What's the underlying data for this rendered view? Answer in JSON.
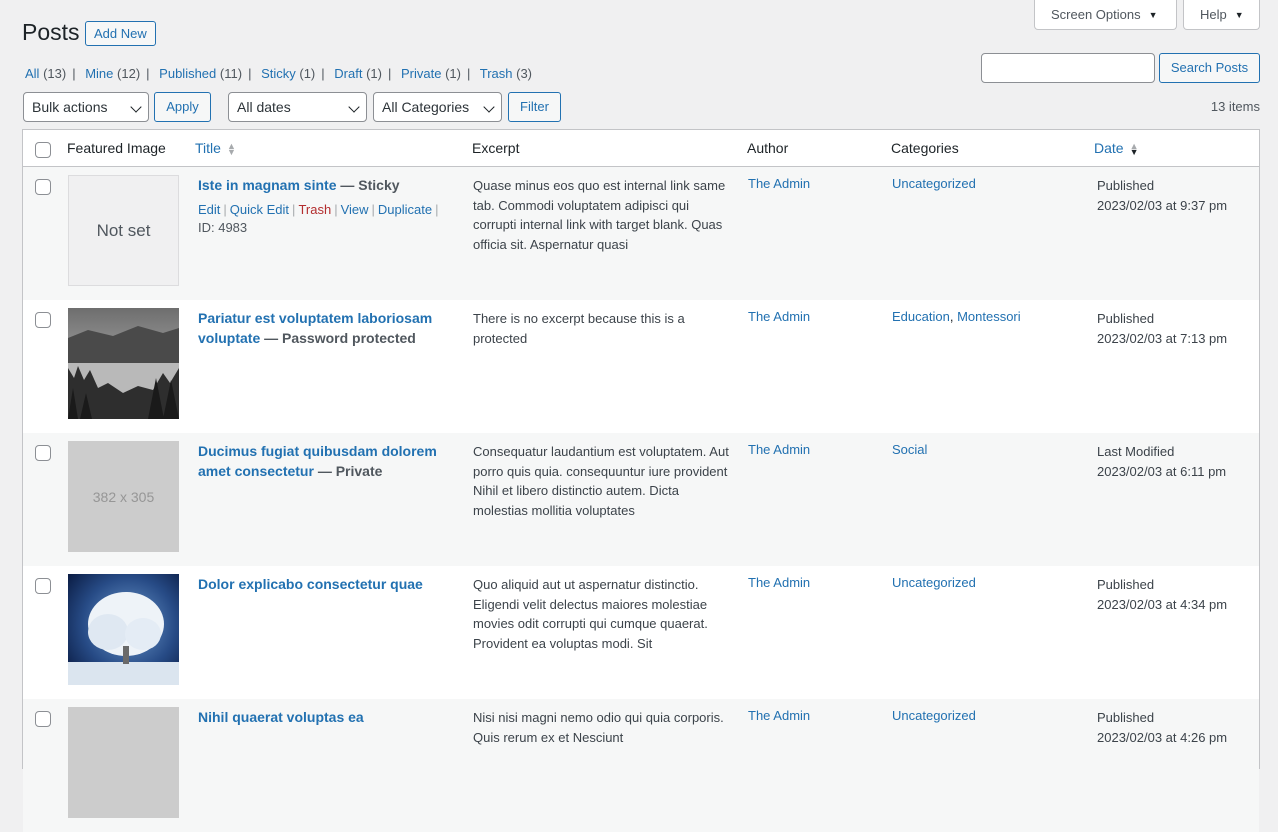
{
  "header": {
    "title": "Posts",
    "add_new": "Add New",
    "screen_options": "Screen Options",
    "help": "Help"
  },
  "views": [
    {
      "label": "All",
      "count": "(13)"
    },
    {
      "label": "Mine",
      "count": "(12)"
    },
    {
      "label": "Published",
      "count": "(11)"
    },
    {
      "label": "Sticky",
      "count": "(1)"
    },
    {
      "label": "Draft",
      "count": "(1)"
    },
    {
      "label": "Private",
      "count": "(1)"
    },
    {
      "label": "Trash",
      "count": "(3)"
    }
  ],
  "search": {
    "button": "Search Posts",
    "value": ""
  },
  "filters": {
    "bulk_actions": "Bulk actions",
    "apply": "Apply",
    "dates": "All dates",
    "categories": "All Categories",
    "filter": "Filter",
    "items": "13 items"
  },
  "columns": {
    "featured_image": "Featured Image",
    "title": "Title",
    "excerpt": "Excerpt",
    "author": "Author",
    "categories": "Categories",
    "date": "Date"
  },
  "rows": [
    {
      "title": "Iste in magnam sinte",
      "state": "— Sticky",
      "thumb_text": "Not set",
      "actions": {
        "edit": "Edit",
        "quick_edit": "Quick Edit",
        "trash": "Trash",
        "view": "View",
        "duplicate": "Duplicate"
      },
      "id": "ID: 4983",
      "excerpt": "Quase minus eos quo est internal link same tab. Commodi voluptatem adipisci qui corrupti internal link with target blank. Quas officia sit. Aspernatur quasi",
      "author": "The Admin",
      "categories": [
        "Uncategorized"
      ],
      "date_status": "Published",
      "date": "2023/02/03 at 9:37 pm"
    },
    {
      "title": "Pariatur est voluptatem laboriosam voluptate",
      "state": "— Password protected",
      "excerpt": "There is no excerpt because this is a protected",
      "author": "The Admin",
      "categories": [
        "Education",
        "Montessori"
      ],
      "date_status": "Published",
      "date": "2023/02/03 at 7:13 pm"
    },
    {
      "title": "Ducimus fugiat quibusdam dolorem amet consectetur",
      "state": "— Private",
      "thumb_text": "382 x 305",
      "excerpt": "Consequatur laudantium est voluptatem. Aut porro quis quia. consequuntur iure provident Nihil et libero distinctio autem. Dicta molestias mollitia voluptates",
      "author": "The Admin",
      "categories": [
        "Social"
      ],
      "date_status": "Last Modified",
      "date": "2023/02/03 at 6:11 pm"
    },
    {
      "title": "Dolor explicabo consectetur quae",
      "excerpt": "Quo aliquid aut ut aspernatur distinctio. Eligendi velit delectus maiores molestiae movies odit corrupti qui cumque quaerat. Provident ea voluptas modi. Sit",
      "author": "The Admin",
      "categories": [
        "Uncategorized"
      ],
      "date_status": "Published",
      "date": "2023/02/03 at 4:34 pm"
    },
    {
      "title": "Nihil quaerat voluptas ea",
      "excerpt": "Nisi nisi magni nemo odio qui quia corporis. Quis rerum ex et Nesciunt",
      "author": "The Admin",
      "categories": [
        "Uncategorized"
      ],
      "date_status": "Published",
      "date": "2023/02/03 at 4:26 pm"
    }
  ]
}
